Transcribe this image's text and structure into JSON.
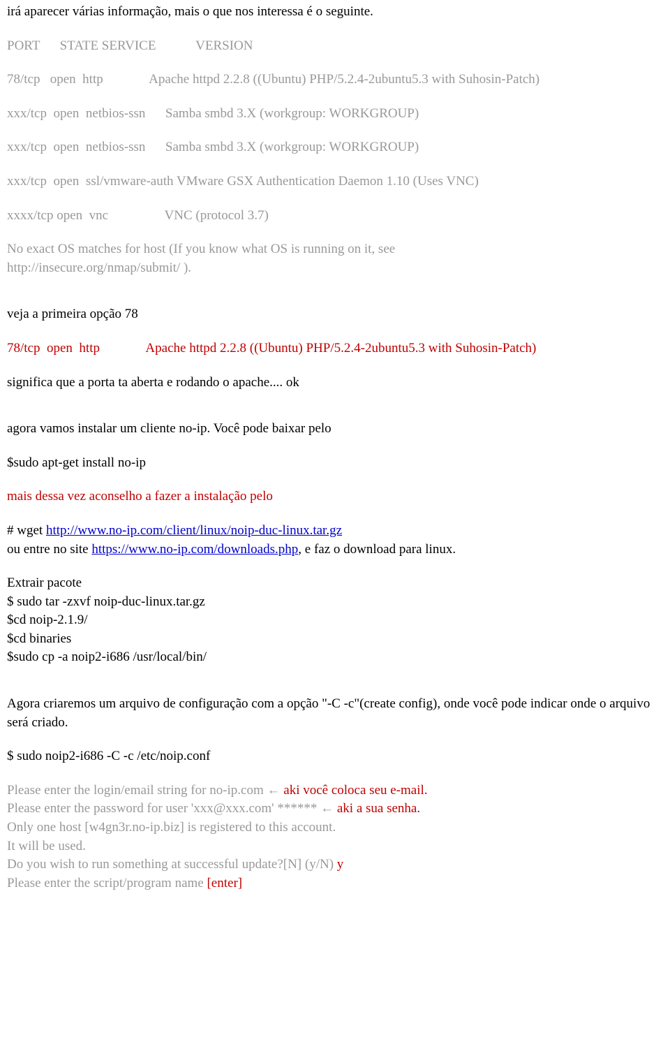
{
  "intro": "irá aparecer várias informação, mais o que nos interessa é o seguinte.",
  "header": "PORT      STATE SERVICE            VERSION",
  "tableRows": [
    "78/tcp   open  http              Apache httpd 2.2.8 ((Ubuntu) PHP/5.2.4-2ubuntu5.3 with Suhosin-Patch)",
    "xxx/tcp  open  netbios-ssn      Samba smbd 3.X (workgroup: WORKGROUP)",
    "xxx/tcp  open  netbios-ssn      Samba smbd 3.X (workgroup: WORKGROUP)",
    "xxx/tcp  open  ssl/vmware-auth VMware GSX Authentication Daemon 1.10 (Uses VNC)",
    "xxxx/tcp open  vnc                 VNC (protocol 3.7)"
  ],
  "osNote1": "No exact OS matches for host (If you know what OS is running on it, see",
  "osNote2": "http://insecure.org/nmap/submit/ ).",
  "veja": "veja a primeira opção 78",
  "redLine": "78/tcp  open  http              Apache httpd 2.2.8 ((Ubuntu) PHP/5.2.4-2ubuntu5.3 with Suhosin-Patch)",
  "significaLine": "significa que a porta ta aberta e rodando o apache.... ok",
  "agoraInstall": "agora vamos instalar um cliente no-ip. Você pode baixar pelo",
  "sudoApt": "$sudo apt-get install no-ip",
  "redAdvice": "mais dessa vez aconselho a fazer a instalação pelo",
  "wgetPrefix": "# wget ",
  "wgetLink": "http://www.no-ip.com/client/linux/noip-duc-linux.tar.gz",
  "ouEntrePrefix": "ou entre no site ",
  "ouEntreLink": "https://www.no-ip.com/downloads.php",
  "ouEntreSuffix": ", e faz o download para linux.",
  "extrairLines": [
    "Extrair pacote",
    "$ sudo tar -zxvf noip-duc-linux.tar.gz",
    "$cd noip-2.1.9/",
    "$cd binaries",
    "$sudo cp -a noip2-i686 /usr/local/bin/"
  ],
  "agoraCriaremos": "Agora criaremos um arquivo de configuração com a opção \"-C -c\"(create config), onde você pode indicar onde o arquivo será criado.",
  "sudoNoip": "$ sudo noip2-i686 -C -c /etc/noip.conf",
  "prompt1gray": "Please enter the login/email string for no-ip.com  ← ",
  "prompt1red": "aki você coloca seu e-mail.",
  "prompt2gray": "Please enter the password for user 'xxx@xxx.com'  ******  ← ",
  "prompt2red": "aki a sua senha.",
  "prompt3": "Only one host [w4gn3r.no-ip.biz] is registered to this account.",
  "prompt4": "It will be used.",
  "prompt5gray": "Do you wish to run something at successful update?[N] (y/N)  ",
  "prompt5red": "y",
  "prompt6gray": "Please enter the script/program name  ",
  "prompt6red": "[enter]"
}
